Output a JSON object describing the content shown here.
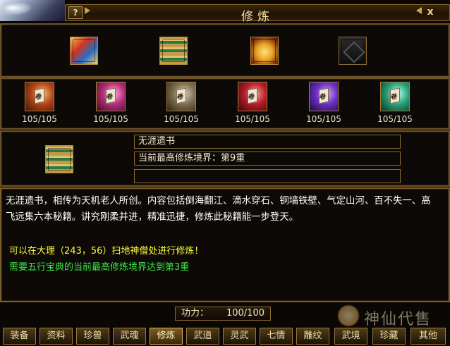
{
  "window": {
    "title": "修炼",
    "help_label": "?",
    "close_label": "x"
  },
  "top_slots": [
    {
      "name": "tome"
    },
    {
      "name": "green-scroll"
    },
    {
      "name": "treasure-chest"
    },
    {
      "name": "empty-slot"
    }
  ],
  "books": [
    {
      "glyph": "卷",
      "count": "105/105"
    },
    {
      "glyph": "卷",
      "count": "105/105"
    },
    {
      "glyph": "卷",
      "count": "105/105"
    },
    {
      "glyph": "卷",
      "count": "105/105"
    },
    {
      "glyph": "卷",
      "count": "105/105"
    },
    {
      "glyph": "卷",
      "count": "105/105"
    }
  ],
  "selected": {
    "name": "无涯遗书",
    "realm": "当前最高修炼境界：第9重",
    "extra": ""
  },
  "description": {
    "text": "无涯遗书，相传为天机老人所创。内容包括倒海翻江、滴水穿石、铜墙铁壁、气定山河、百不失一、高飞远集六本秘籍。讲究刚柔并进，精准迅捷，修炼此秘籍能一步登天。",
    "location": "可以在大理（243，56）扫地神僧处进行修炼！",
    "requirement": "需要五行宝典的当前最高修炼境界达到第3重"
  },
  "power": {
    "label": "功力：",
    "value": "100/100"
  },
  "watermark": "神仙代售",
  "tabs": [
    "装备",
    "资料",
    "珍兽",
    "武魂",
    "修炼",
    "武道",
    "灵武",
    "七情",
    "雕纹",
    "武境",
    "珍藏",
    "其他"
  ],
  "active_tab": "修炼"
}
